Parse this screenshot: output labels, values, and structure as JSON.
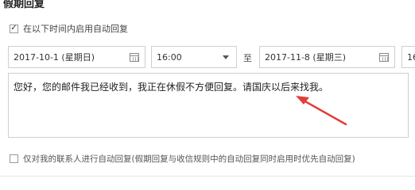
{
  "page": {
    "title": "假期回复"
  },
  "auto_reply": {
    "enable_checked": true,
    "enable_label": "在以下时间内启用自动回复",
    "start_date": "2017-10-1 (星期日)",
    "start_time": "16:00",
    "to_label": "至",
    "end_date": "2017-11-8 (星期三)",
    "end_time_partial": "16",
    "message": "您好，您的邮件我已经收到，我正在休假不方便回复。请国庆以后来找我。",
    "contacts_only_checked": false,
    "contacts_only_label": "仅对我的联系人进行自动回复(假期回复与收信规则中的自动回复同时启用时优先自动回复)"
  },
  "icons": {
    "calendar": "calendar-icon",
    "dropdown": "chevron-down-icon",
    "check": "✓"
  },
  "colors": {
    "annotation_arrow": "#e0403a"
  }
}
